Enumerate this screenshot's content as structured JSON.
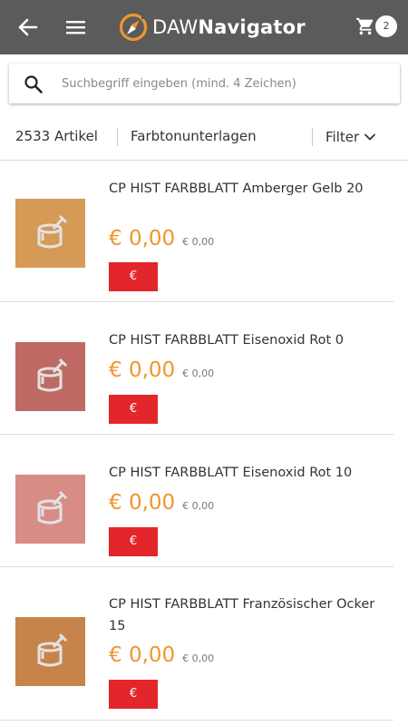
{
  "header": {
    "logo_prefix": "DAW",
    "logo_suffix": "Navigator",
    "cart_count": "2",
    "icons": [
      "back-arrow-icon",
      "hamburger-menu-icon",
      "compass-icon",
      "cart-icon"
    ]
  },
  "search": {
    "placeholder": "Suchbegriff eingeben (mind. 4 Zeichen)",
    "value": ""
  },
  "filterbar": {
    "count": "2533 Artikel",
    "category": "Farbtonunterlagen",
    "filter_label": "Filter"
  },
  "products": [
    {
      "name": "CP HIST FARBBLATT Amberger Gelb 20",
      "price": "€ 0,00",
      "old_price": "€ 0,00",
      "button": "€",
      "swatch": "#d59a55"
    },
    {
      "name": "CP HIST FARBBLATT Eisenoxid Rot 0",
      "price": "€ 0,00",
      "old_price": "€ 0,00",
      "button": "€",
      "swatch": "#bf6a64"
    },
    {
      "name": "CP HIST FARBBLATT Eisenoxid Rot 10",
      "price": "€ 0,00",
      "old_price": "€ 0,00",
      "button": "€",
      "swatch": "#d88c86"
    },
    {
      "name": "CP HIST FARBBLATT Französischer Ocker 15",
      "price": "€ 0,00",
      "old_price": "€ 0,00",
      "button": "€",
      "swatch": "#c7844a"
    }
  ],
  "colors": {
    "appbar": "#5b5b5b",
    "accent_orange": "#f0962b",
    "buy_red": "#e3262b"
  }
}
